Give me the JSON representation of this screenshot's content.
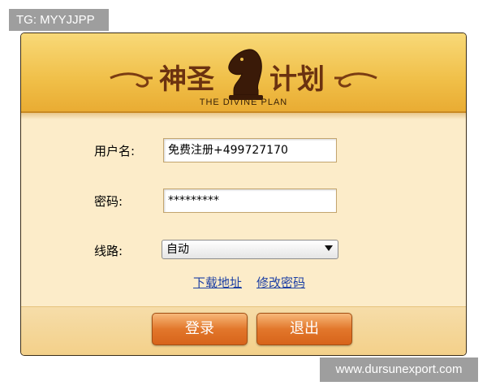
{
  "tag": "TG: MYYJJPP",
  "banner": {
    "title_left": "神圣",
    "title_right": "计划",
    "subtitle": "THE DIVINE PLAN",
    "logo_icon": "chess-knight-icon"
  },
  "form": {
    "username_label": "用户名:",
    "username_value": "免费注册+499727170",
    "password_label": "密码:",
    "password_value": "*********",
    "route_label": "线路:",
    "route_value": "自动",
    "download_link": "下载地址",
    "change_password_link": "修改密码"
  },
  "buttons": {
    "login": "登录",
    "exit": "退出"
  },
  "watermark": "www.dursunexport.com",
  "colors": {
    "banner": "#f0bf48",
    "body": "#fcecc9",
    "button": "#e2772b",
    "link": "#1c3fa4",
    "title": "#6b3210"
  }
}
